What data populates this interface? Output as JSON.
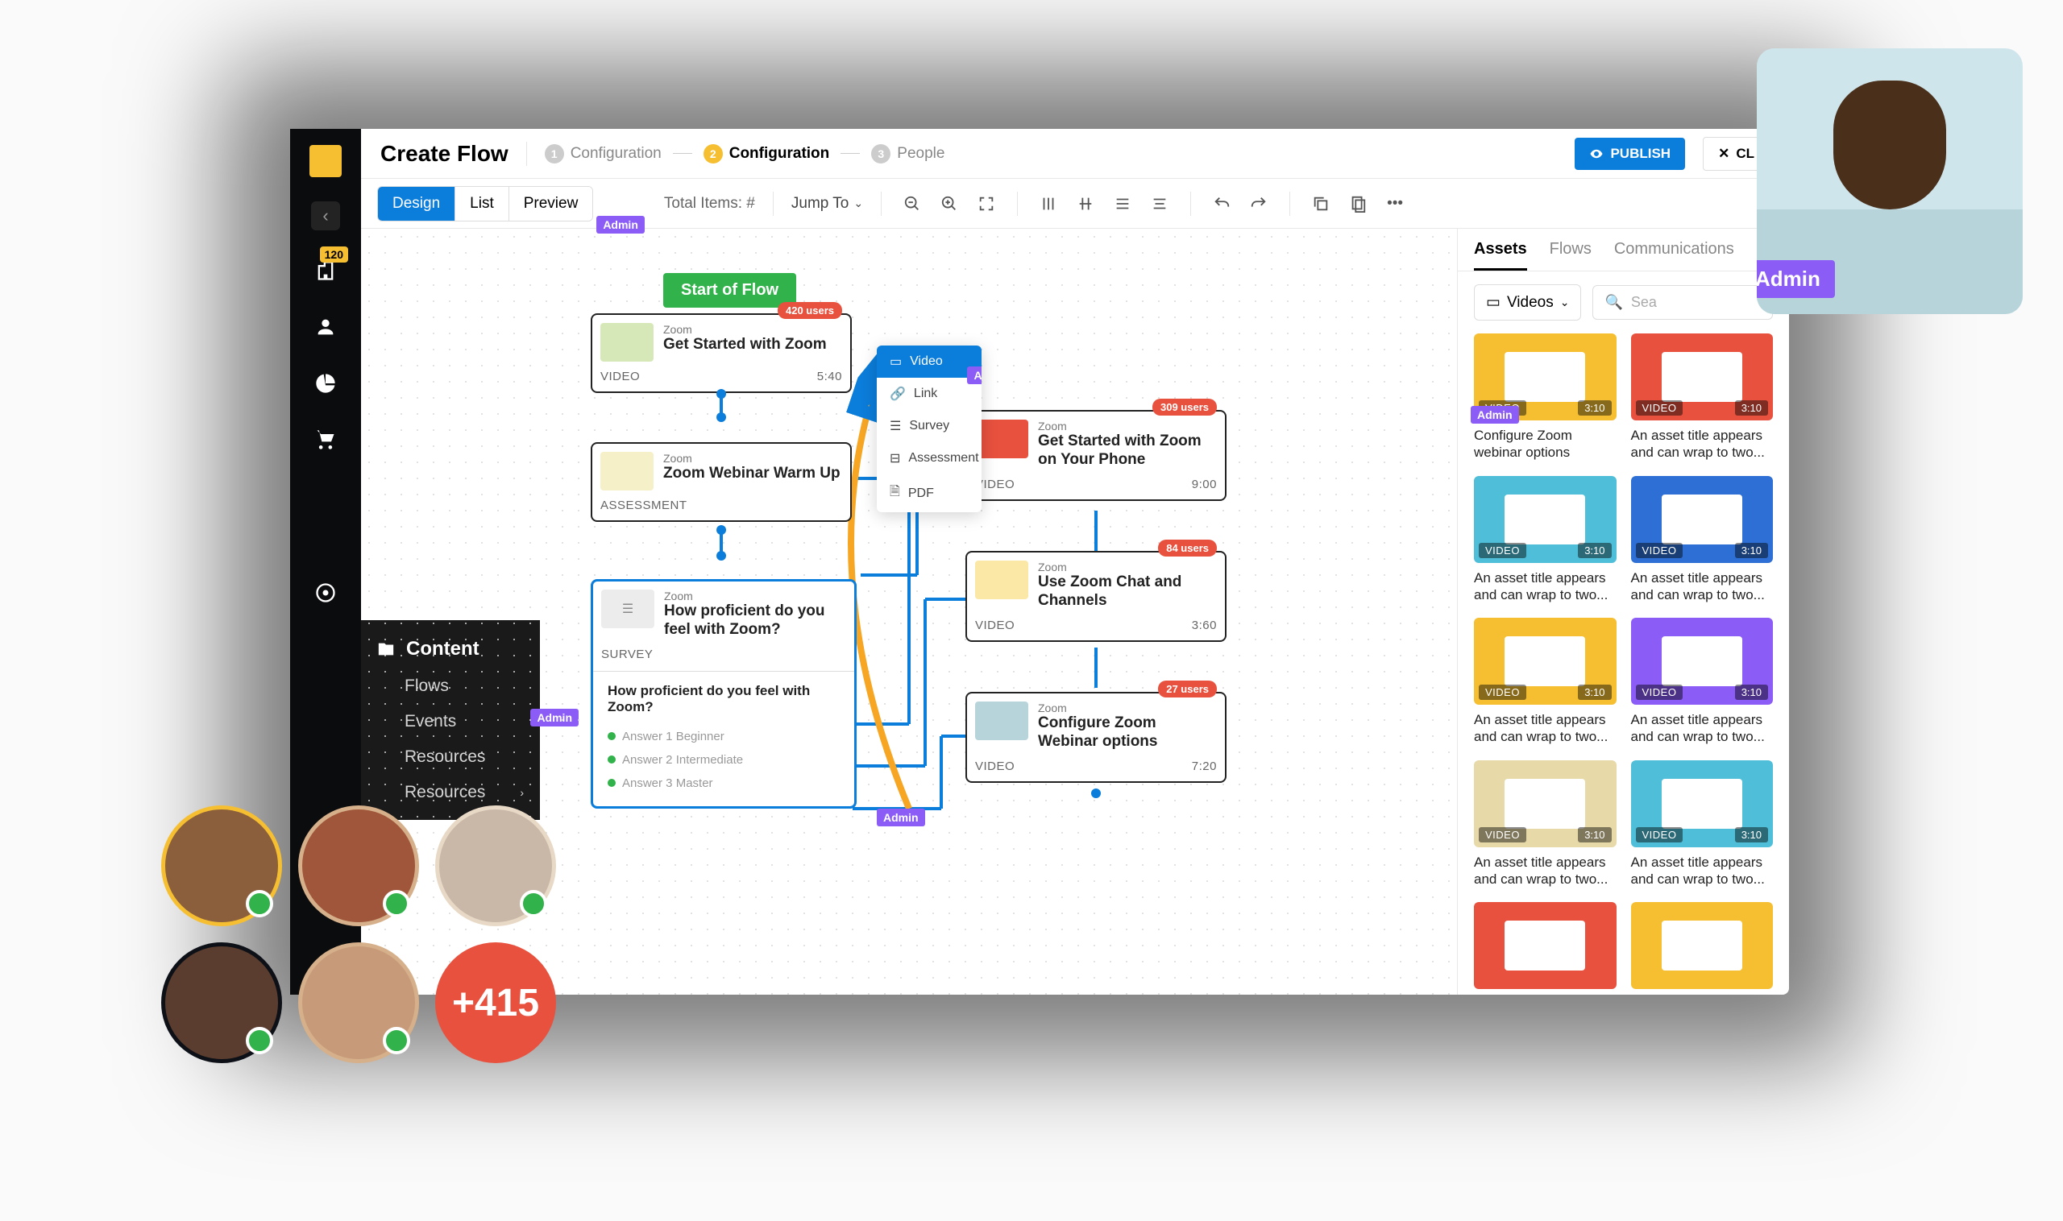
{
  "header": {
    "title": "Create Flow",
    "steps": [
      {
        "n": "1",
        "label": "Configuration",
        "active": false
      },
      {
        "n": "2",
        "label": "Configuration",
        "active": true
      },
      {
        "n": "3",
        "label": "People",
        "active": false
      }
    ],
    "publish": "PUBLISH",
    "close": "CL"
  },
  "toolbar": {
    "design": "Design",
    "list": "List",
    "preview": "Preview",
    "total_items": "Total Items: #",
    "jump": "Jump To"
  },
  "sidebar": {
    "badge": "120",
    "content_menu": {
      "header": "Content",
      "items": [
        "Flows",
        "Events",
        "Resources",
        "Resources"
      ]
    }
  },
  "canvas": {
    "start": "Start of Flow",
    "nodes": [
      {
        "id": 0,
        "cat": "Zoom",
        "title": "Get Started with Zoom",
        "type": "VIDEO",
        "dur": "5:40",
        "users": "420 users",
        "thumb": "#d7e8b8"
      },
      {
        "id": 1,
        "cat": "Zoom",
        "title": "Zoom Webinar Warm Up",
        "type": "ASSESSMENT",
        "dur": "",
        "users": "",
        "thumb": "#f6f0c8"
      },
      {
        "id": 2,
        "cat": "Zoom",
        "title": "How proficient do you feel with Zoom?",
        "type": "SURVEY",
        "dur": "",
        "users": "",
        "thumb": "#ececec",
        "survey": {
          "q": "How proficient do you feel with Zoom?",
          "answers": [
            "Answer 1 Beginner",
            "Answer 2 Intermediate",
            "Answer 3 Master"
          ]
        }
      },
      {
        "id": 3,
        "cat": "Zoom",
        "title": "Get Started with Zoom on Your Phone",
        "type": "VIDEO",
        "dur": "9:00",
        "users": "309 users",
        "thumb": "#e8513e"
      },
      {
        "id": 4,
        "cat": "Zoom",
        "title": "Use Zoom Chat and Channels",
        "type": "VIDEO",
        "dur": "3:60",
        "users": "84 users",
        "thumb": "#fbe8a6"
      },
      {
        "id": 5,
        "cat": "Zoom",
        "title": "Configure Zoom Webinar options",
        "type": "VIDEO",
        "dur": "7:20",
        "users": "27 users",
        "thumb": "#b8d4db"
      }
    ],
    "popup": [
      "Video",
      "Link",
      "Survey",
      "Assessment",
      "PDF"
    ]
  },
  "panel": {
    "tabs": [
      "Assets",
      "Flows",
      "Communications"
    ],
    "filter": "Videos",
    "search": "Sea",
    "cards": [
      {
        "color": "#f6bf32",
        "cap": "Configure Zoom webinar options",
        "dur": "3:10",
        "type": "VIDEO",
        "admin": true
      },
      {
        "color": "#e8513e",
        "cap": "An asset title appears and can wrap to two...",
        "dur": "3:10",
        "type": "VIDEO"
      },
      {
        "color": "#4fbfd9",
        "cap": "An asset title appears and can wrap to two...",
        "dur": "3:10",
        "type": "VIDEO"
      },
      {
        "color": "#2e6fd6",
        "cap": "An asset title appears and can wrap to two...",
        "dur": "3:10",
        "type": "VIDEO"
      },
      {
        "color": "#f6bf32",
        "cap": "An asset title appears and can wrap to two...",
        "dur": "3:10",
        "type": "VIDEO"
      },
      {
        "color": "#8b5cf6",
        "cap": "An asset title appears and can wrap to two...",
        "dur": "3:10",
        "type": "VIDEO"
      },
      {
        "color": "#e8d9a8",
        "cap": "An asset title appears and can wrap to two...",
        "dur": "3:10",
        "type": "VIDEO"
      },
      {
        "color": "#4fbfd9",
        "cap": "An asset title appears and can wrap to two...",
        "dur": "3:10",
        "type": "VIDEO"
      },
      {
        "color": "#e8513e",
        "cap": "",
        "dur": "",
        "type": ""
      },
      {
        "color": "#f6bf32",
        "cap": "",
        "dur": "",
        "type": ""
      }
    ]
  },
  "tags": {
    "admin": "Admin"
  },
  "overlay": {
    "counter": "+415",
    "big_admin": "Admin"
  }
}
